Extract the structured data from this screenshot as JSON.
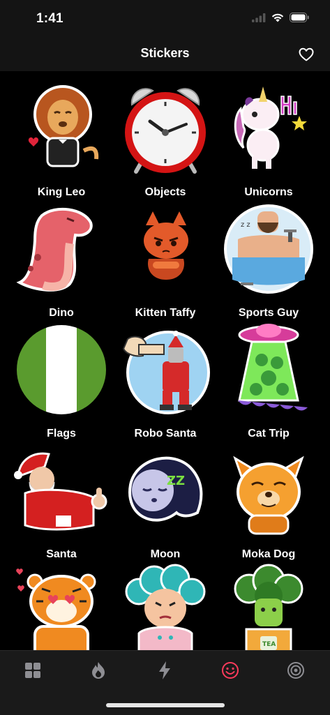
{
  "status_bar": {
    "time": "1:41"
  },
  "header": {
    "title": "Stickers"
  },
  "sticker_packs": [
    {
      "name": "King Leo",
      "icon": "lion-king-sticker"
    },
    {
      "name": "Objects",
      "icon": "alarm-clock-sticker"
    },
    {
      "name": "Unicorns",
      "icon": "unicorn-hi-sticker"
    },
    {
      "name": "Dino",
      "icon": "pink-dino-sticker"
    },
    {
      "name": "Kitten Taffy",
      "icon": "grumpy-kitten-sticker"
    },
    {
      "name": "Sports Guy",
      "icon": "sports-guy-sticker"
    },
    {
      "name": "Flags",
      "icon": "nigeria-flag-sticker"
    },
    {
      "name": "Robo Santa",
      "icon": "robo-santa-sticker"
    },
    {
      "name": "Cat Trip",
      "icon": "ufo-cat-trip-sticker"
    },
    {
      "name": "Santa",
      "icon": "santa-thumbs-up-sticker"
    },
    {
      "name": "Moon",
      "icon": "sleepy-moon-sticker"
    },
    {
      "name": "Moka Dog",
      "icon": "moka-dog-sticker"
    },
    {
      "name": "",
      "icon": "tiger-sticker"
    },
    {
      "name": "",
      "icon": "curly-hair-girl-sticker"
    },
    {
      "name": "",
      "icon": "broccoli-tea-sticker"
    }
  ],
  "tab_bar": {
    "tabs": [
      {
        "icon": "grid-icon"
      },
      {
        "icon": "flame-icon"
      },
      {
        "icon": "bolt-icon"
      },
      {
        "icon": "smiley-icon",
        "selected": true
      },
      {
        "icon": "radar-icon"
      }
    ],
    "selected_color": "#ff3b5c",
    "inactive_color": "#8e8e93"
  }
}
